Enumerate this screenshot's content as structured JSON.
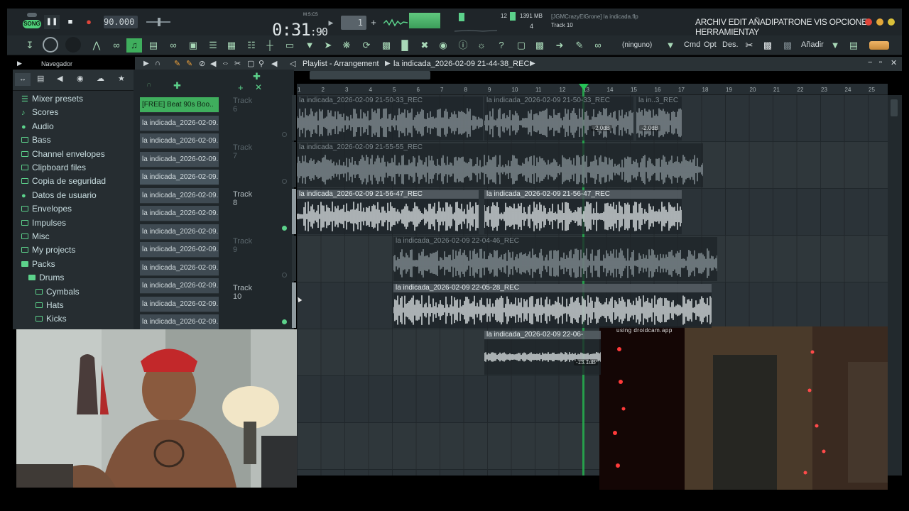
{
  "transport": {
    "song_label": "SONG",
    "bpm": "90.000",
    "time_main": "0:31",
    "time_sub": ":90",
    "time_format_label": "M:S:CS",
    "pattern_number": "1",
    "memory_cpu": "12",
    "memory_mb": "1391 MB",
    "voices": "4"
  },
  "hint_bar": {
    "project_file": "[JGMCrazyElGrone] la indicada.flp",
    "hint": "Track 10"
  },
  "menu": {
    "text": "ARCHIV EDIT AÑADIPATRONE VIS OPCIONE HERRAMIENTAY"
  },
  "toolbar2": {
    "pattern_name": "(ninguno)",
    "labels": [
      "Cmd",
      "Opt",
      "Des.",
      "Añadir"
    ]
  },
  "playlist": {
    "navigator_label": "Navegador",
    "title": "Playlist - Arrangement",
    "breadcrumb": "la indicada_2026-02-09 21-44-38_REC",
    "ruler": [
      "1",
      "2",
      "3",
      "4",
      "5",
      "6",
      "7",
      "8",
      "9",
      "10",
      "11",
      "12",
      "13",
      "14",
      "15",
      "16",
      "17",
      "18",
      "19",
      "20",
      "21",
      "22",
      "23",
      "24",
      "25"
    ]
  },
  "browser": {
    "items": [
      {
        "label": "Mixer presets",
        "icon": "mixer-preset-icon",
        "indent": 0
      },
      {
        "label": "Scores",
        "icon": "note-icon",
        "indent": 0
      },
      {
        "label": "Audio",
        "icon": "person-icon",
        "indent": 0
      },
      {
        "label": "Bass",
        "icon": "folder-icon",
        "indent": 0
      },
      {
        "label": "Channel envelopes",
        "icon": "folder-icon",
        "indent": 0
      },
      {
        "label": "Clipboard files",
        "icon": "folder-icon",
        "indent": 0
      },
      {
        "label": "Copia de seguridad",
        "icon": "folder-icon",
        "indent": 0
      },
      {
        "label": "Datos de usuario",
        "icon": "person-icon",
        "indent": 0
      },
      {
        "label": "Envelopes",
        "icon": "folder-icon",
        "indent": 0
      },
      {
        "label": "Impulses",
        "icon": "folder-icon",
        "indent": 0
      },
      {
        "label": "Misc",
        "icon": "folder-icon",
        "indent": 0
      },
      {
        "label": "My projects",
        "icon": "folder-icon",
        "indent": 0
      },
      {
        "label": "Packs",
        "icon": "folder-open-icon",
        "indent": 0
      },
      {
        "label": "Drums",
        "icon": "folder-open-icon",
        "indent": 1
      },
      {
        "label": "Cymbals",
        "icon": "folder-icon",
        "indent": 2
      },
      {
        "label": "Hats",
        "icon": "folder-icon",
        "indent": 2
      },
      {
        "label": "Kicks",
        "icon": "folder-icon",
        "indent": 2
      }
    ]
  },
  "channels": [
    "[FREE] Beat 90s Boo..",
    "la indicada_2026-02-09..",
    "la indicada_2026-02-09..",
    "la indicada_2026-02-09..",
    "la indicada_2026-02-09..",
    "la indicada_2026-02-09..",
    "la indicada_2026-02-09..",
    "la indicada_2026-02-09..",
    "la indicada_2026-02-09..",
    "la indicada_2026-02-09..",
    "la indicada_2026-02-09..",
    "la indicada_2026-02-09..",
    "la indicada_2026-02-09.."
  ],
  "tracks": [
    {
      "label": "Track 6",
      "active": false
    },
    {
      "label": "Track 7",
      "active": false
    },
    {
      "label": "Track 8",
      "active": true
    },
    {
      "label": "Track 9",
      "active": false
    },
    {
      "label": "Track 10",
      "active": true
    }
  ],
  "clips": [
    {
      "lane": 0,
      "title": "la indicada_2026-02-09 21-50-33_REC",
      "muted": true
    },
    {
      "lane": 0,
      "title": "la indicada_2026-02-09 21-50-33_REC",
      "muted": true,
      "gain": "-2.0dB"
    },
    {
      "lane": 0,
      "title": "la in..3_REC",
      "muted": true,
      "gain": "-2.0dB"
    },
    {
      "lane": 1,
      "title": "la indicada_2026-02-09 21-55-55_REC",
      "muted": true
    },
    {
      "lane": 2,
      "title": "la indicada_2026-02-09 21-56-47_REC",
      "muted": false
    },
    {
      "lane": 2,
      "title": "la indicada_2026-02-09 21-56-47_REC",
      "muted": false
    },
    {
      "lane": 3,
      "title": "la indicada_2026-02-09 22-04-46_REC",
      "muted": true
    },
    {
      "lane": 4,
      "title": "la indicada_2026-02-09 22-05-28_REC",
      "muted": false
    },
    {
      "lane": 5,
      "title": "la indicada_2026-02-09 22-06-",
      "muted": false,
      "gain": "-13.1dB"
    }
  ],
  "webcam": {
    "watermark": "using droidcam.app"
  },
  "colors": {
    "accent_green": "#5cd28b",
    "playhead": "#26b24f",
    "record_red": "#e0453a"
  }
}
